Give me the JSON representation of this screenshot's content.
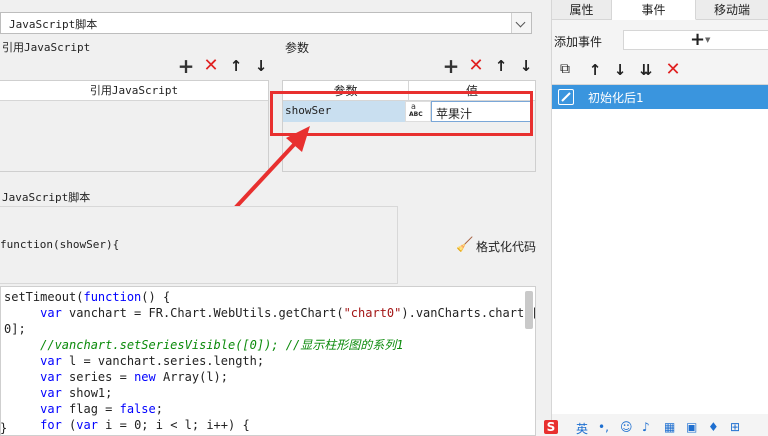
{
  "script_select": {
    "value": "JavaScript脚本"
  },
  "sections": {
    "ref_js_label": "引用JavaScript",
    "params_label": "参数",
    "js_script_label": "JavaScript脚本",
    "format_code": "格式化代码"
  },
  "ref_table": {
    "header": "引用JavaScript"
  },
  "params_table": {
    "col_param": "参数",
    "col_value": "值",
    "row": {
      "param": "showSer",
      "type_badge": "ABC",
      "value": "苹果汁"
    }
  },
  "function_signature": "function(showSer){",
  "code_lines": [
    {
      "indent": "",
      "parts": [
        {
          "t": "setTimeout(",
          "c": ""
        },
        {
          "t": "function",
          "c": "kw"
        },
        {
          "t": "() {",
          "c": ""
        }
      ]
    },
    {
      "indent": "     ",
      "parts": [
        {
          "t": "var",
          "c": "kw"
        },
        {
          "t": " vanchart = FR.Chart.WebUtils.getChart(",
          "c": ""
        },
        {
          "t": "\"chart0\"",
          "c": "str"
        },
        {
          "t": ").vanCharts.charts[",
          "c": ""
        }
      ]
    },
    {
      "indent": "",
      "parts": [
        {
          "t": "0];",
          "c": ""
        }
      ]
    },
    {
      "indent": "     ",
      "parts": [
        {
          "t": "//vanchart.setSeriesVisible([0]); //显示柱形图的系列1",
          "c": "cmt"
        }
      ]
    },
    {
      "indent": "     ",
      "parts": [
        {
          "t": "var",
          "c": "kw"
        },
        {
          "t": " l = vanchart.series.length;",
          "c": ""
        }
      ]
    },
    {
      "indent": "     ",
      "parts": [
        {
          "t": "var",
          "c": "kw"
        },
        {
          "t": " series = ",
          "c": ""
        },
        {
          "t": "new",
          "c": "kw"
        },
        {
          "t": " Array(l);",
          "c": ""
        }
      ]
    },
    {
      "indent": "     ",
      "parts": [
        {
          "t": "var",
          "c": "kw"
        },
        {
          "t": " show1;",
          "c": ""
        }
      ]
    },
    {
      "indent": "     ",
      "parts": [
        {
          "t": "var",
          "c": "kw"
        },
        {
          "t": " flag = ",
          "c": ""
        },
        {
          "t": "false",
          "c": "kw"
        },
        {
          "t": ";",
          "c": ""
        }
      ]
    },
    {
      "indent": "     ",
      "parts": [
        {
          "t": "for",
          "c": "kw"
        },
        {
          "t": " (",
          "c": ""
        },
        {
          "t": "var",
          "c": "kw"
        },
        {
          "t": " i = 0; i < l; i++) {",
          "c": ""
        }
      ]
    }
  ],
  "closing_brace": "}",
  "right_panel": {
    "tabs": [
      "属性",
      "事件",
      "移动端"
    ],
    "active_tab": "事件",
    "add_event_label": "添加事件",
    "event_item": "初始化后1"
  },
  "ime_bar": {
    "lang": "英"
  },
  "colors": {
    "accent": "#3a95de",
    "annotation_red": "#e8302f",
    "selection": "#c9dff0"
  }
}
